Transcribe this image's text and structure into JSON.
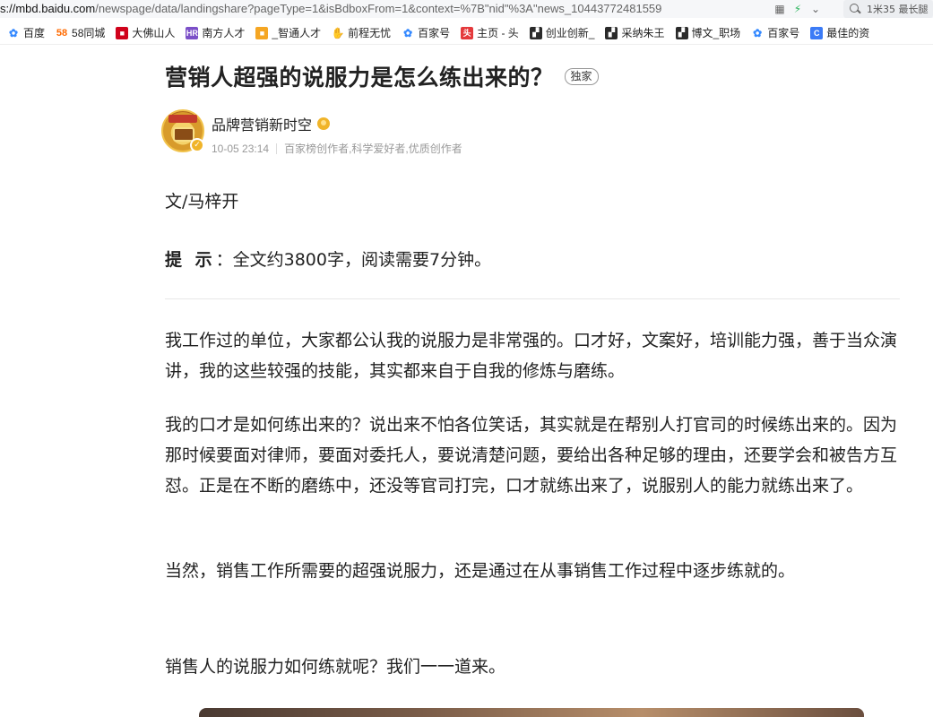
{
  "browser": {
    "url_host": "s://mbd.baidu.com",
    "url_rest": "/newspage/data/landingshare?pageType=1&isBdboxFrom=1&context=%7B\"nid\"%3A\"news_10443772481559",
    "search_text": "1米35 最长腿"
  },
  "bookmarks": [
    {
      "label": "百度",
      "icon": "paw-icon",
      "color": "#3388ff"
    },
    {
      "label": "58同城",
      "icon": "58-icon",
      "color": "#ff6a00"
    },
    {
      "label": "大佛山人",
      "icon": "site-icon",
      "color": "#d0021b"
    },
    {
      "label": "南方人才",
      "icon": "hr-icon",
      "color": "#7b4fc8"
    },
    {
      "label": "_智通人才",
      "icon": "site-icon",
      "color": "#f5a623"
    },
    {
      "label": "前程无忧",
      "icon": "hand-icon",
      "color": "#666666"
    },
    {
      "label": "百家号",
      "icon": "paw-icon",
      "color": "#3388ff"
    },
    {
      "label": "主页 - 头",
      "icon": "toutiao-icon",
      "color": "#e4393c"
    },
    {
      "label": "创业创新_",
      "icon": "flag-icon",
      "color": "#2a2a2a"
    },
    {
      "label": "采纳朱王",
      "icon": "flag-icon",
      "color": "#2a2a2a"
    },
    {
      "label": "博文_职场",
      "icon": "flag-icon",
      "color": "#2a2a2a"
    },
    {
      "label": "百家号",
      "icon": "paw-icon",
      "color": "#3388ff"
    },
    {
      "label": "最佳的资",
      "icon": "c-icon",
      "color": "#3b7bf6"
    }
  ],
  "article": {
    "title": "营销人超强的说服力是怎么练出来的？",
    "badge": "独家",
    "author_name": "品牌营销新时空",
    "date": "10-05 23:14",
    "author_tags": "百家榜创作者,科学爱好者,优质创作者",
    "byline": "文/马梓开",
    "tip_label": "提 示",
    "tip_text": "：全文约3800字，阅读需要7分钟。",
    "paragraphs": [
      "我工作过的单位，大家都公认我的说服力是非常强的。口才好，文案好，培训能力强，善于当众演讲，我的这些较强的技能，其实都来自于自我的修炼与磨练。",
      "我的口才是如何练出来的？说出来不怕各位笑话，其实就是在帮别人打官司的时候练出来的。因为那时候要面对律师，要面对委托人，要说清楚问题，要给出各种足够的理由，还要学会和被告方互怼。正是在不断的磨练中，还没等官司打完，口才就练出来了，说服别人的能力就练出来了。",
      "当然，销售工作所需要的超强说服力，还是通过在从事销售工作过程中逐步练就的。",
      "销售人的说服力如何练就呢？我们一一道来。"
    ]
  }
}
